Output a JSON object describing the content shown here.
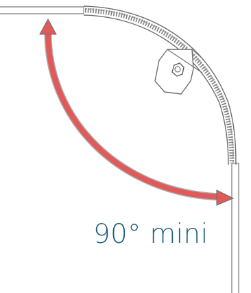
{
  "caption": "90° mini",
  "colors": {
    "arrow": "#e05a5a",
    "caption": "#1f5f7f",
    "outline": "#6d6d6d"
  },
  "icons": {
    "bolt": "hex-bolt-icon"
  }
}
